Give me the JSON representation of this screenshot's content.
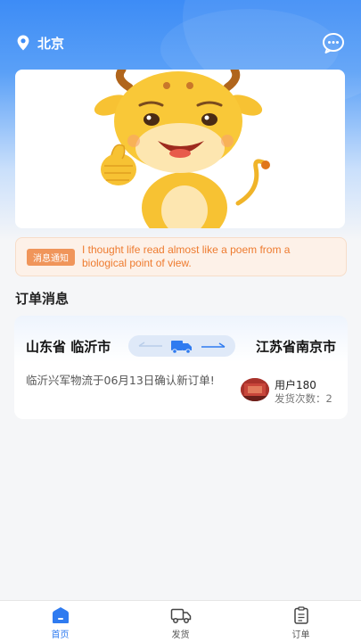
{
  "header": {
    "city": "北京",
    "location_icon": "location-pin-icon",
    "chat_icon": "chat-bubble-icon"
  },
  "banner": {
    "image": "cartoon-cow-mascot"
  },
  "notice": {
    "tag": "消息通知",
    "text": "I thought life read almost like a poem from a biological point of view."
  },
  "orders": {
    "section_title": "订单消息",
    "items": [
      {
        "from": "山东省 临沂市",
        "to": "江苏省南京市",
        "message": "临沂兴军物流于06月13日确认新订单!",
        "user": "用户180",
        "send_count": "发货次数：2"
      }
    ]
  },
  "tabbar": {
    "items": [
      {
        "label": "首页",
        "icon": "home-icon",
        "active": true
      },
      {
        "label": "发货",
        "icon": "truck-icon",
        "active": false
      },
      {
        "label": "订单",
        "icon": "clipboard-icon",
        "active": false
      }
    ]
  },
  "colors": {
    "primary": "#2f7bf0",
    "notice_bg": "#fdf1e8",
    "notice_text": "#ee7b2f",
    "notice_tag": "#f0955a"
  }
}
